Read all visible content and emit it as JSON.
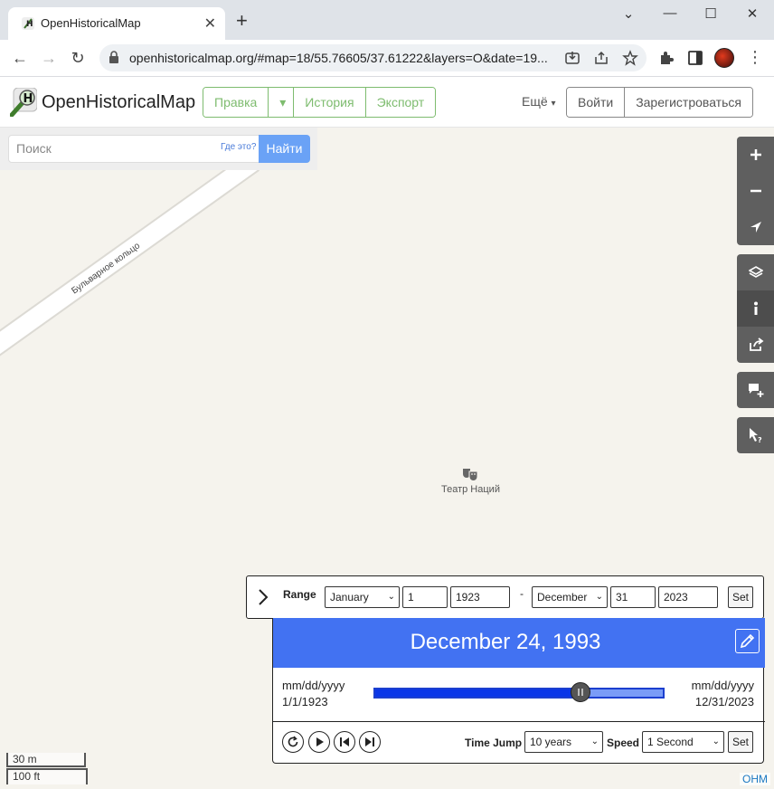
{
  "browser": {
    "tab_title": "OpenHistoricalMap",
    "new_tab": "+",
    "url": "openhistoricalmap.org/#map=18/55.76605/37.61222&layers=O&date=19..."
  },
  "site": {
    "brand": "OpenHistoricalMap",
    "nav": {
      "edit": "Правка",
      "history": "История",
      "export": "Экспорт"
    },
    "more": "Ещё",
    "login": "Войти",
    "signup": "Зарегистроваться"
  },
  "search": {
    "placeholder": "Поиск",
    "where_is": "Где это?",
    "button": "Найти"
  },
  "map": {
    "road_label": "Бульварное кольцо",
    "poi_label": "Театр Наций",
    "poi_icon": "theatre-icon",
    "controls": [
      "zoom-in-icon",
      "zoom-out-icon",
      "locate-icon",
      "layers-icon",
      "info-icon",
      "share-icon",
      "add-note-icon",
      "query-icon"
    ],
    "scale_m": "30 m",
    "scale_ft": "100 ft",
    "attribution": "OHM"
  },
  "timeslider": {
    "range_label": "Range",
    "start_month": "January",
    "start_day": "1",
    "start_year": "1923",
    "separator": "-",
    "end_month": "December",
    "end_day": "31",
    "end_year": "2023",
    "set_label": "Set",
    "current_date": "December 24, 1993",
    "left_format": "mm/dd/yyyy",
    "left_value": "1/1/1923",
    "right_format": "mm/dd/yyyy",
    "right_value": "12/31/2023",
    "slider_position": 0.7098,
    "time_jump_label": "Time Jump",
    "time_jump_value": "10 years",
    "speed_label": "Speed",
    "speed_value": "1 Second",
    "set2_label": "Set",
    "accent_color": "#4272f2"
  }
}
